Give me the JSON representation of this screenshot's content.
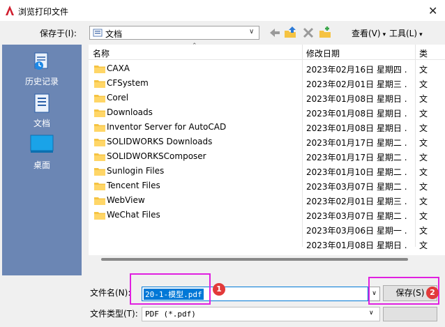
{
  "window": {
    "title": "浏览打印文件",
    "close_glyph": "✕"
  },
  "toolbar": {
    "save_in_label": "保存于(I):",
    "save_in_value": "文档",
    "view_label": "查看(V)",
    "tools_label": "工具(L)"
  },
  "places": [
    {
      "label": "历史记录",
      "icon": "history-icon"
    },
    {
      "label": "文档",
      "icon": "documents-icon"
    },
    {
      "label": "桌面",
      "icon": "desktop-icon"
    }
  ],
  "file_list": {
    "columns": {
      "name": "名称",
      "date": "修改日期",
      "type": "类"
    },
    "rows": [
      {
        "name": "CAXA",
        "date": "2023年02月16日 星期四 ...",
        "type": "文"
      },
      {
        "name": "CFSystem",
        "date": "2023年02月01日 星期三 ...",
        "type": "文"
      },
      {
        "name": "Corel",
        "date": "2023年01月08日 星期日 ...",
        "type": "文"
      },
      {
        "name": "Downloads",
        "date": "2023年01月08日 星期日 ...",
        "type": "文"
      },
      {
        "name": "Inventor Server for AutoCAD",
        "date": "2023年01月08日 星期日 ...",
        "type": "文"
      },
      {
        "name": "SOLIDWORKS Downloads",
        "date": "2023年01月17日 星期二 ...",
        "type": "文"
      },
      {
        "name": "SOLIDWORKSComposer",
        "date": "2023年01月17日 星期二 ...",
        "type": "文"
      },
      {
        "name": "Sunlogin Files",
        "date": "2023年01月10日 星期二 ...",
        "type": "文"
      },
      {
        "name": "Tencent Files",
        "date": "2023年03月07日 星期二 ...",
        "type": "文"
      },
      {
        "name": "WebView",
        "date": "2023年02月01日 星期三 ...",
        "type": "文"
      },
      {
        "name": "WeChat Files",
        "date": "2023年03月07日 星期二 ...",
        "type": "文"
      },
      {
        "name": "",
        "date": "2023年03月06日 星期一 ...",
        "type": "文"
      },
      {
        "name": "",
        "date": "2023年01月08日 星期日 ...",
        "type": "文"
      }
    ]
  },
  "bottom": {
    "filename_label": "文件名(N):",
    "filename_value": "20-1-模型.pdf",
    "filetype_label": "文件类型(T):",
    "filetype_value": "PDF (*.pdf)",
    "save_button": "保存(S)"
  },
  "annotations": {
    "badge1": "1",
    "badge2": "2",
    "highlight_color": "#e020e0",
    "badge_color": "#e23a3a"
  },
  "colors": {
    "accent": "#0078d7",
    "places_bg": "#6b86b4",
    "folder": "#f5c342"
  }
}
